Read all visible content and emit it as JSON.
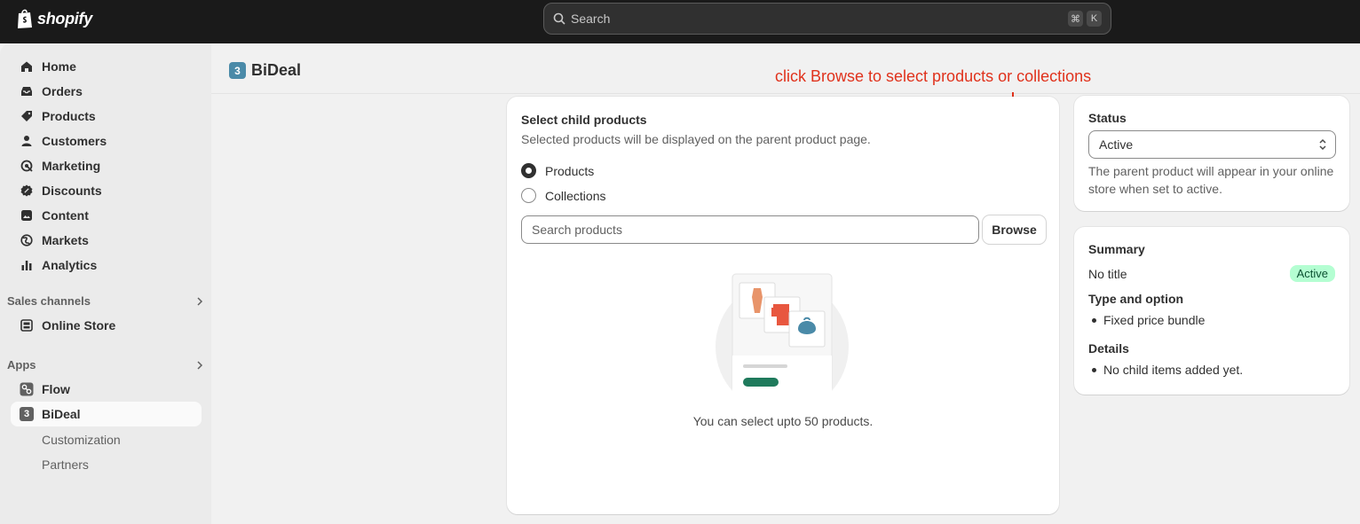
{
  "topbar": {
    "brand": "shopify",
    "search_placeholder": "Search",
    "shortcut_keys": [
      "⌘",
      "K"
    ]
  },
  "sidebar": {
    "items": [
      {
        "label": "Home",
        "icon": "home-icon"
      },
      {
        "label": "Orders",
        "icon": "inbox-icon"
      },
      {
        "label": "Products",
        "icon": "tag-icon"
      },
      {
        "label": "Customers",
        "icon": "person-icon"
      },
      {
        "label": "Marketing",
        "icon": "target-icon"
      },
      {
        "label": "Discounts",
        "icon": "discount-icon"
      },
      {
        "label": "Content",
        "icon": "content-icon"
      },
      {
        "label": "Markets",
        "icon": "globe-icon"
      },
      {
        "label": "Analytics",
        "icon": "bar-chart-icon"
      }
    ],
    "sales_channels_label": "Sales channels",
    "online_store_label": "Online Store",
    "apps_label": "Apps",
    "flow_label": "Flow",
    "bideal_label": "BiDeal",
    "bideal_badge": "3",
    "sub_items": [
      "Customization",
      "Partners"
    ]
  },
  "header": {
    "app_title": "BiDeal",
    "app_badge": "3"
  },
  "annotation": {
    "text": "click Browse to select products or collections",
    "color": "#e0321c"
  },
  "child_products": {
    "title": "Select child products",
    "description": "Selected products will be displayed on the parent product page.",
    "options": [
      "Products",
      "Collections"
    ],
    "selected": "Products",
    "search_placeholder": "Search products",
    "browse_label": "Browse",
    "empty_text": "You can select upto 50 products."
  },
  "status_card": {
    "title": "Status",
    "value": "Active",
    "help": "The parent product will appear in your online store when set to active."
  },
  "summary_card": {
    "title": "Summary",
    "product_title": "No title",
    "badge": "Active",
    "type_heading": "Type and option",
    "type_items": [
      "Fixed price bundle"
    ],
    "details_heading": "Details",
    "details_items": [
      "No child items added yet."
    ]
  },
  "colors": {
    "topbar": "#1a1a1a",
    "accent_teal": "#4a8aa8",
    "badge_green": "#b4fed2",
    "button_green": "#1f7a5c"
  }
}
